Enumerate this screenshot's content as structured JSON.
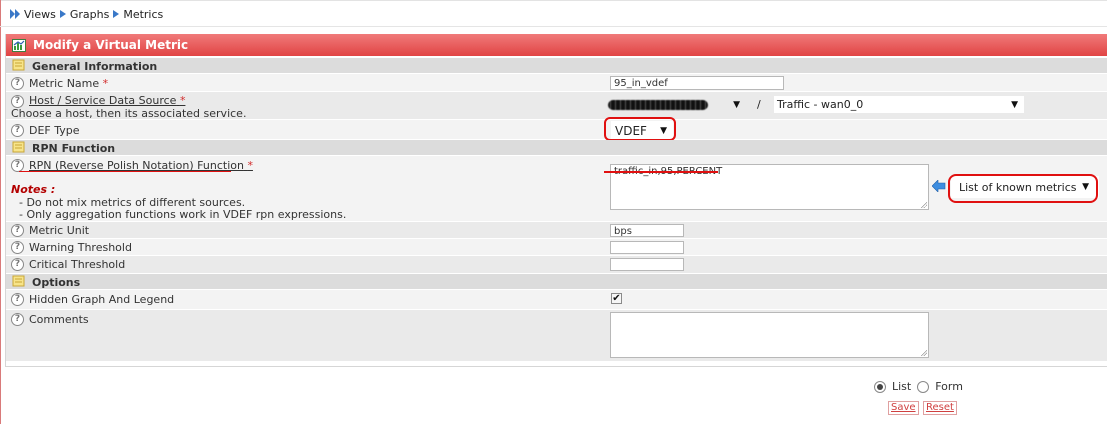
{
  "breadcrumb": {
    "items": [
      "Views",
      "Graphs",
      "Metrics"
    ]
  },
  "panel": {
    "title": "Modify a Virtual Metric"
  },
  "sections": {
    "general": "General Information",
    "rpn": "RPN Function",
    "options": "Options"
  },
  "fields": {
    "metric_name": {
      "label": "Metric Name",
      "required": "*",
      "value": "95_in_vdef"
    },
    "host_service": {
      "label": "Host / Service Data Source",
      "required": "*",
      "help_text": "Choose a host, then its associated service.",
      "separator": "/",
      "service_value": "Traffic - wan0_0"
    },
    "def_type": {
      "label": "DEF Type",
      "value": "VDEF"
    },
    "rpn_function": {
      "label": "RPN (Reverse Polish Notation) Function",
      "required": "*",
      "value": "traffic_in,95,PERCENT",
      "known_metrics": "List of known metrics"
    },
    "notes": {
      "title": "Notes :",
      "lines": [
        "- Do not mix metrics of different sources.",
        "- Only aggregation functions work in VDEF rpn expressions."
      ]
    },
    "metric_unit": {
      "label": "Metric Unit",
      "value": "bps"
    },
    "warning_threshold": {
      "label": "Warning Threshold",
      "value": ""
    },
    "critical_threshold": {
      "label": "Critical Threshold",
      "value": ""
    },
    "hidden_graph": {
      "label": "Hidden Graph And Legend",
      "checked": true,
      "mark": "✔"
    },
    "comments": {
      "label": "Comments",
      "value": ""
    }
  },
  "footer": {
    "mode_list": "List",
    "mode_form": "Form",
    "save": "Save",
    "reset": "Reset"
  },
  "icons": {
    "help": "?",
    "dropdown": "▼",
    "arrow_left": "arrow-left-icon"
  },
  "colors": {
    "title_bar": "#e14444",
    "annotation_red": "#e01010",
    "section_bg": "#dcdcdc"
  }
}
